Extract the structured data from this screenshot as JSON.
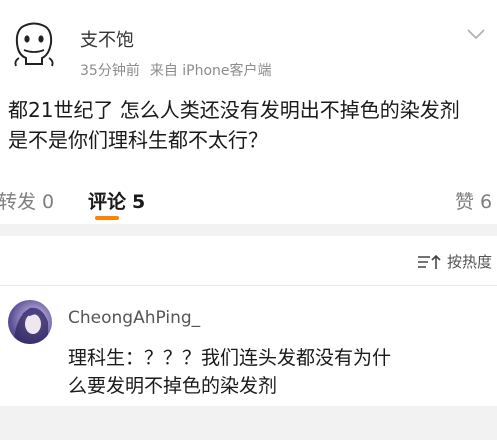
{
  "post": {
    "author": "支不饱",
    "time": "35分钟前",
    "source": "来自 iPhone客户端",
    "text_lines": [
      "都21世纪了 怎么人类还没有发明出不掉色的染发剂",
      "是不是你们理科生都不太行？"
    ]
  },
  "actions": {
    "repost_label": "转发",
    "repost_count": "0",
    "comment_label": "评论",
    "comment_count": "5",
    "like_label": "赞",
    "like_count": "6",
    "accent_color": "#ff8200"
  },
  "comments": {
    "sort_label": "按热度",
    "sort_icon": "sort-icon",
    "items": [
      {
        "username": "CheongAhPing_",
        "text_lines": [
          "理科生：？？？我们连头发都没有为什",
          "么要发明不掉色的染发剂"
        ]
      }
    ]
  }
}
